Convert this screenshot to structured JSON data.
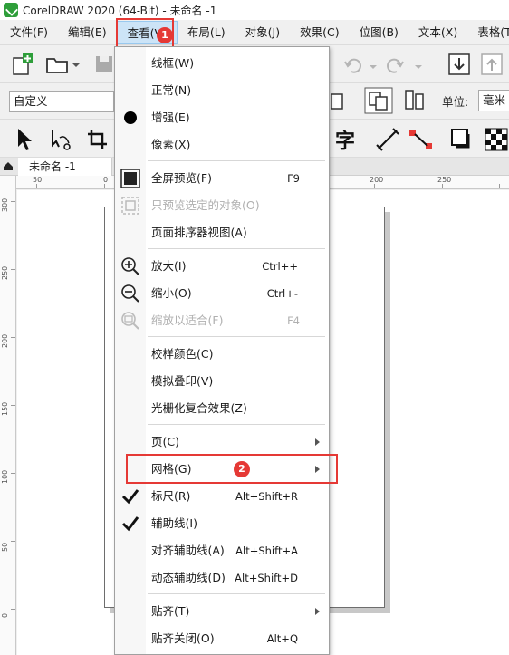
{
  "title": "CorelDRAW 2020 (64-Bit) - 未命名 -1",
  "menubar": [
    {
      "label": "文件(F)"
    },
    {
      "label": "编辑(E)"
    },
    {
      "label": "查看(V)"
    },
    {
      "label": "布局(L)"
    },
    {
      "label": "对象(J)"
    },
    {
      "label": "效果(C)"
    },
    {
      "label": "位图(B)"
    },
    {
      "label": "文本(X)"
    },
    {
      "label": "表格(T)"
    }
  ],
  "property_bar": {
    "preset": "自定义",
    "unit_label": "单位:",
    "unit_value": "毫米"
  },
  "doc_tab": "未命名 -1",
  "ruler_h": [
    "50",
    "0",
    "200",
    "250"
  ],
  "ruler_v": [
    "300",
    "250",
    "200",
    "150",
    "100",
    "50",
    "0"
  ],
  "view_menu": {
    "items": [
      {
        "label": "线框(W)",
        "shortcut": "",
        "icon": "",
        "disabled": false
      },
      {
        "label": "正常(N)",
        "shortcut": "",
        "icon": "",
        "disabled": false
      },
      {
        "label": "增强(E)",
        "shortcut": "",
        "icon": "bullet-icon",
        "disabled": false
      },
      {
        "label": "像素(X)",
        "shortcut": "",
        "icon": "",
        "disabled": false
      },
      {
        "label": "全屏预览(F)",
        "shortcut": "F9",
        "icon": "full-screen-preview-icon",
        "disabled": false
      },
      {
        "label": "只预览选定的对象(O)",
        "shortcut": "",
        "icon": "preview-selected-icon",
        "disabled": true
      },
      {
        "label": "页面排序器视图(A)",
        "shortcut": "",
        "icon": "",
        "disabled": false
      },
      {
        "label": "放大(I)",
        "shortcut": "Ctrl++",
        "icon": "zoom-in-icon",
        "disabled": false
      },
      {
        "label": "缩小(O)",
        "shortcut": "Ctrl+-",
        "icon": "zoom-out-icon",
        "disabled": false
      },
      {
        "label": "缩放以适合(F)",
        "shortcut": "F4",
        "icon": "zoom-to-fit-icon",
        "disabled": true
      },
      {
        "label": "校样颜色(C)",
        "shortcut": "",
        "icon": "",
        "disabled": false
      },
      {
        "label": "模拟叠印(V)",
        "shortcut": "",
        "icon": "",
        "disabled": false
      },
      {
        "label": "光栅化复合效果(Z)",
        "shortcut": "",
        "icon": "",
        "disabled": false
      },
      {
        "label": "页(C)",
        "shortcut": "",
        "icon": "",
        "disabled": false,
        "submenu": true
      },
      {
        "label": "网格(G)",
        "shortcut": "",
        "icon": "",
        "disabled": false,
        "submenu": true
      },
      {
        "label": "标尺(R)",
        "shortcut": "Alt+Shift+R",
        "icon": "checkmark-icon",
        "disabled": false
      },
      {
        "label": "辅助线(I)",
        "shortcut": "",
        "icon": "checkmark-icon",
        "disabled": false
      },
      {
        "label": "对齐辅助线(A)",
        "shortcut": "Alt+Shift+A",
        "icon": "",
        "disabled": false
      },
      {
        "label": "动态辅助线(D)",
        "shortcut": "Alt+Shift+D",
        "icon": "",
        "disabled": false
      },
      {
        "label": "贴齐(T)",
        "shortcut": "",
        "icon": "",
        "disabled": false,
        "submenu": true
      },
      {
        "label": "贴齐关闭(O)",
        "shortcut": "Alt+Q",
        "icon": "",
        "disabled": false
      }
    ]
  },
  "annotations": {
    "badge1": "1",
    "badge2": "2"
  },
  "colors": {
    "accent": "#e53935",
    "menu_highlight": "#cce4f7"
  }
}
